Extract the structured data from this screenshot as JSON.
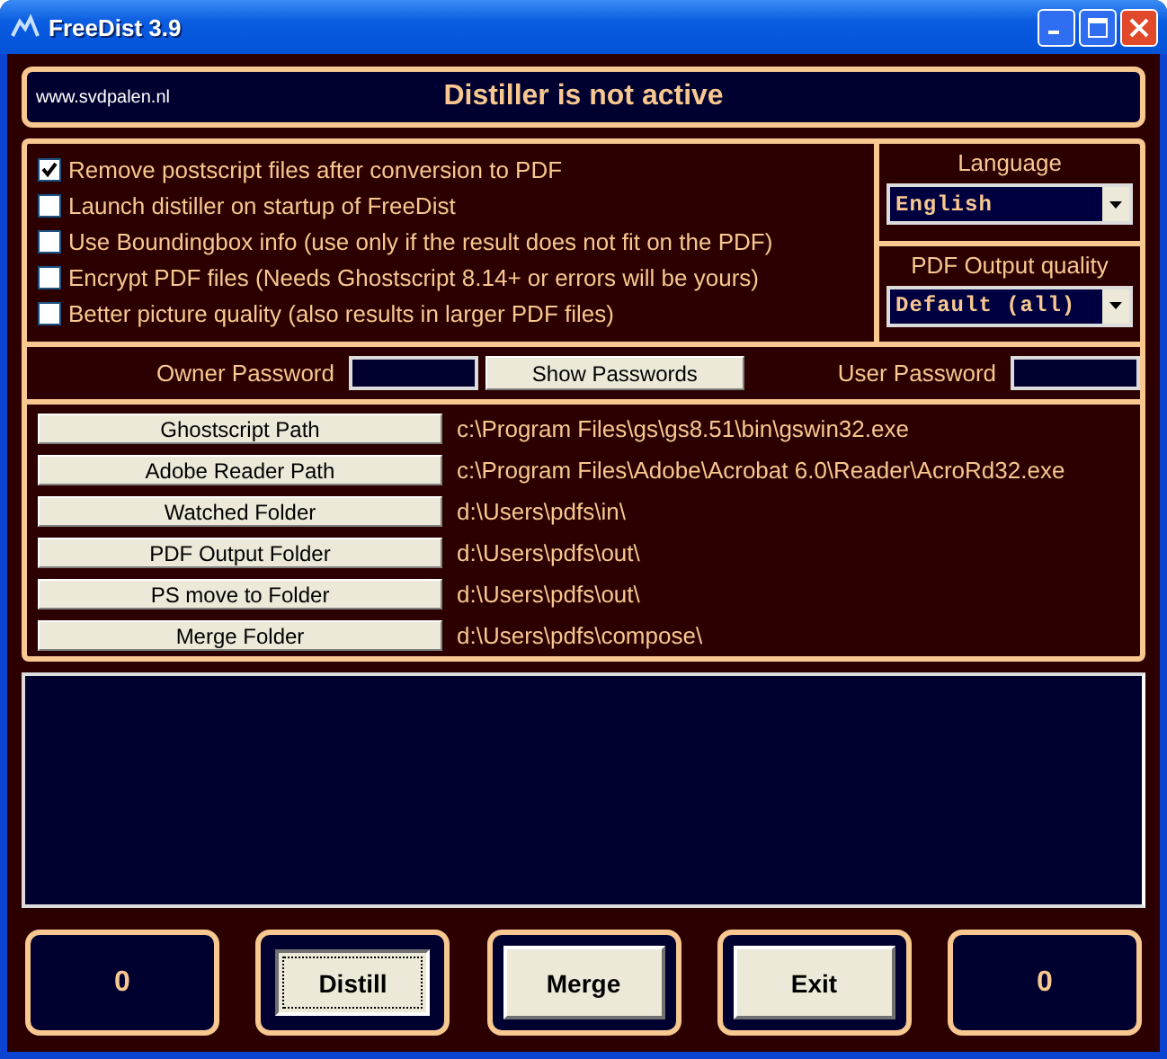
{
  "window": {
    "title": "FreeDist 3.9"
  },
  "header": {
    "website": "www.svdpalen.nl",
    "status": "Distiller is not active"
  },
  "options": [
    {
      "label": "Remove postscript files after conversion to PDF",
      "checked": true
    },
    {
      "label": "Launch distiller on startup of FreeDist",
      "checked": false
    },
    {
      "label": "Use Boundingbox info (use only if the result does not fit on the PDF)",
      "checked": false
    },
    {
      "label": "Encrypt PDF files (Needs Ghostscript 8.14+  or errors will be yours)",
      "checked": false
    },
    {
      "label": "Better picture quality (also results in larger PDF files)",
      "checked": false
    }
  ],
  "language": {
    "label": "Language",
    "value": "English"
  },
  "quality": {
    "label": "PDF Output quality",
    "value": "Default (all)"
  },
  "passwords": {
    "owner_label": "Owner Password",
    "show_button": "Show Passwords",
    "user_label": "User Password"
  },
  "paths": [
    {
      "button": "Ghostscript Path",
      "value": "c:\\Program Files\\gs\\gs8.51\\bin\\gswin32.exe"
    },
    {
      "button": "Adobe Reader Path",
      "value": "c:\\Program Files\\Adobe\\Acrobat 6.0\\Reader\\AcroRd32.exe"
    },
    {
      "button": "Watched Folder",
      "value": "d:\\Users\\pdfs\\in\\"
    },
    {
      "button": "PDF Output Folder",
      "value": "d:\\Users\\pdfs\\out\\"
    },
    {
      "button": "PS move to Folder",
      "value": "d:\\Users\\pdfs\\out\\"
    },
    {
      "button": "Merge Folder",
      "value": "d:\\Users\\pdfs\\compose\\"
    }
  ],
  "bottom": [
    {
      "kind": "counter",
      "text": "0"
    },
    {
      "kind": "button",
      "text": "Distill",
      "focused": true
    },
    {
      "kind": "button",
      "text": "Merge",
      "focused": false
    },
    {
      "kind": "button",
      "text": "Exit",
      "focused": false
    },
    {
      "kind": "counter",
      "text": "0"
    }
  ]
}
